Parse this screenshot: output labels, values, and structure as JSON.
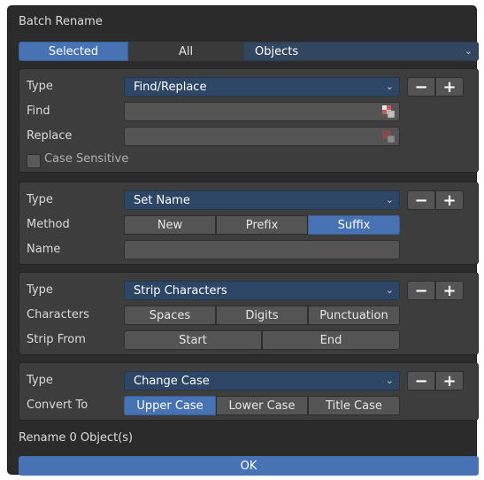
{
  "dialog": {
    "title": "Batch Rename",
    "scope_tabs": [
      {
        "label": "Selected",
        "active": true
      },
      {
        "label": "All",
        "active": false
      }
    ],
    "target_type": "Objects"
  },
  "rules": [
    {
      "type_label": "Type",
      "type_value": "Find/Replace",
      "find_label": "Find",
      "find_value": "",
      "replace_label": "Replace",
      "replace_value": "",
      "case_sensitive_label": "Case Sensitive",
      "case_sensitive": false
    },
    {
      "type_label": "Type",
      "type_value": "Set Name",
      "method_label": "Method",
      "method_options": [
        "New",
        "Prefix",
        "Suffix"
      ],
      "method_selected": "Suffix",
      "name_label": "Name",
      "name_value": ""
    },
    {
      "type_label": "Type",
      "type_value": "Strip Characters",
      "characters_label": "Characters",
      "characters_options": [
        "Spaces",
        "Digits",
        "Punctuation"
      ],
      "strip_from_label": "Strip From",
      "strip_from_options": [
        "Start",
        "End"
      ]
    },
    {
      "type_label": "Type",
      "type_value": "Change Case",
      "convert_label": "Convert To",
      "convert_options": [
        "Upper Case",
        "Lower Case",
        "Title Case"
      ],
      "convert_selected": "Upper Case"
    }
  ],
  "status_text": "Rename 0 Object(s)",
  "ok_label": "OK",
  "icons": {
    "remove": "−",
    "add": "+",
    "chevron": "⌄"
  },
  "colors": {
    "accent": "#4772b3",
    "panel": "#3d3d3d",
    "background": "#2b2b2b"
  }
}
